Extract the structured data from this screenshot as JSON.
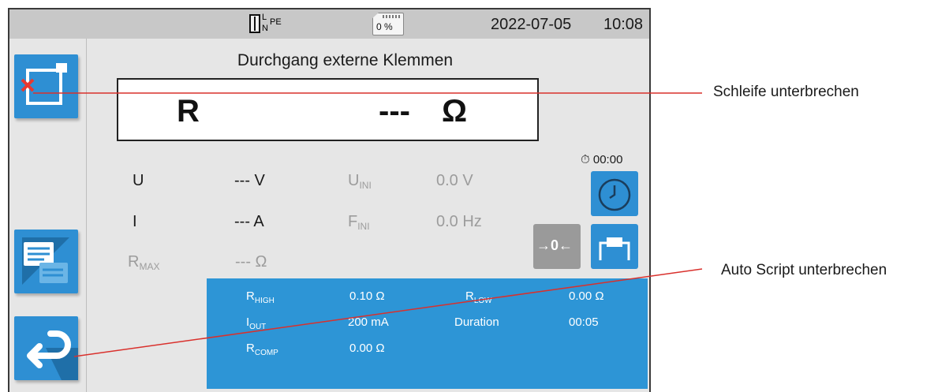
{
  "status_bar": {
    "wiring_label_l": "L",
    "wiring_label_n": "N",
    "wiring_label_pe": "PE",
    "sd_card_percent": "0 %",
    "date": "2022-07-05",
    "time": "10:08"
  },
  "sidebar": {
    "buttons": [
      "exit-loop-button",
      "script-list-button",
      "back-button"
    ]
  },
  "main": {
    "title": "Durchgang externe Klemmen",
    "result_symbol": "R",
    "result_value": "---",
    "result_unit": "Ω"
  },
  "measurements": {
    "u_label": "U",
    "u_value": "--- V",
    "i_label": "I",
    "i_value": "--- A",
    "rmax_label": "R",
    "rmax_sub": "MAX",
    "rmax_value": "--- Ω",
    "uini_label": "U",
    "uini_sub": "INI",
    "uini_value": "0.0 V",
    "fini_label": "F",
    "fini_sub": "INI",
    "fini_value": "0.0 Hz"
  },
  "timer": {
    "value": "00:00"
  },
  "tools": {
    "zero_label": "→0←"
  },
  "parameters": {
    "rhigh_label": "R",
    "rhigh_sub": "HIGH",
    "rhigh_value": "0.10 Ω",
    "rlow_label": "R",
    "rlow_sub": "LOW",
    "rlow_value": "0.00 Ω",
    "iout_label": "I",
    "iout_sub": "OUT",
    "iout_value": "200 mA",
    "duration_label": "Duration",
    "duration_value": "00:05",
    "rcomp_label": "R",
    "rcomp_sub": "COMP",
    "rcomp_value": "0.00 Ω"
  },
  "annotations": {
    "loop": "Schleife unterbrechen",
    "script": "Auto Script unterbrechen"
  },
  "colors": {
    "button_blue": "#2e8fd3",
    "panel_blue": "#2d95d6",
    "callout_red": "#d9302c",
    "gray_button": "#9a9a9a"
  }
}
